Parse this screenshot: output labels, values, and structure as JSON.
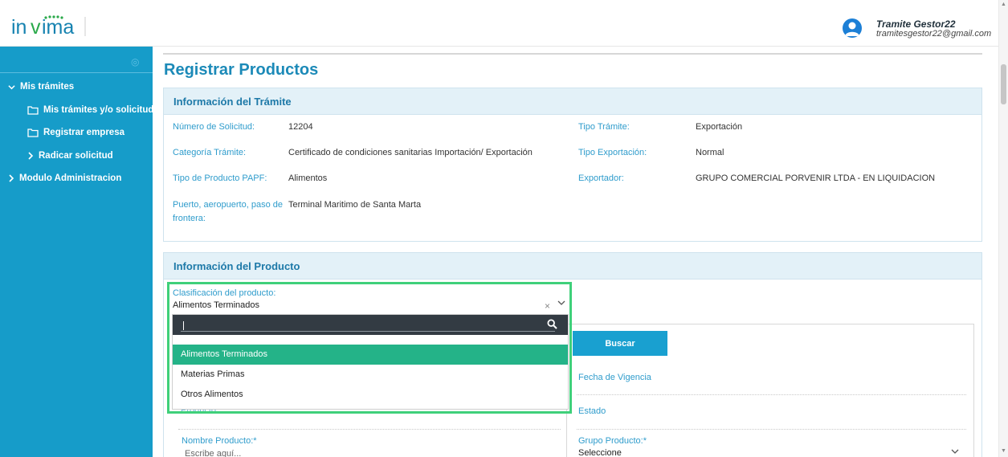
{
  "brand": {
    "name": "invima"
  },
  "user": {
    "name": "Tramite Gestor22",
    "email": "tramitesgestor22@gmail.com"
  },
  "sidebar": {
    "items": [
      {
        "label": "Mis trámites"
      },
      {
        "label": "Mis trámites y/o solicitudes"
      },
      {
        "label": "Registrar empresa"
      },
      {
        "label": "Radicar solicitud"
      },
      {
        "label": "Modulo Administracion"
      }
    ]
  },
  "page": {
    "title": "Registrar Productos"
  },
  "tramite": {
    "header": "Información del Trámite",
    "fields": {
      "numero_label": "Número de Solicitud:",
      "numero_value": "12204",
      "tipo_tramite_label": "Tipo Trámite:",
      "tipo_tramite_value": "Exportación",
      "categoria_label": "Categoría Trámite:",
      "categoria_value": "Certificado de condiciones sanitarias Importación/ Exportación",
      "tipo_exportacion_label": "Tipo Exportación:",
      "tipo_exportacion_value": "Normal",
      "tipo_producto_label": "Tipo de Producto PAPF:",
      "tipo_producto_value": "Alimentos",
      "exportador_label": "Exportador:",
      "exportador_value": "GRUPO COMERCIAL PORVENIR LTDA - EN LIQUIDACION",
      "puerto_label_line1": "Puerto, aeropuerto, paso de",
      "puerto_label_line2": "frontera:",
      "puerto_value": "Terminal Maritimo de Santa Marta"
    }
  },
  "producto": {
    "header": "Información del Producto",
    "clasificacion_label": "Clasificación del producto:",
    "clasificacion_value": "Alimentos Terminados",
    "dropdown_options": [
      "Alimentos Terminados",
      "Materias Primas",
      "Otros Alimentos"
    ],
    "buscar_label": "Buscar",
    "fecha_vigencia_label": "Fecha de Vigencia",
    "estado_label": "Estado",
    "partial_label": "Producto",
    "nombre_producto_label": "Nombre Producto:*",
    "nombre_producto_placeholder": "Escribe aquí...",
    "grupo_producto_label": "Grupo Producto:*",
    "grupo_producto_value": "Seleccione"
  },
  "colors": {
    "sidebar": "#169cc9",
    "accent": "#1c8ab8",
    "selected_option": "#24b388",
    "highlight": "#3fd07a"
  }
}
